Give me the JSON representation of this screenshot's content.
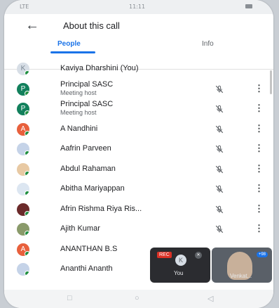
{
  "status_bar": {
    "network": "LTE",
    "time": "11:11"
  },
  "header": {
    "title": "About this call",
    "tabs": [
      "People",
      "Info"
    ]
  },
  "participants": [
    {
      "name": "Kaviya Dharshini (You)",
      "initial": "K",
      "color": "#d7dee6",
      "text_color": "#7a8793",
      "subtitle": "",
      "mic": false
    },
    {
      "name": "Principal SASC",
      "initial": "P",
      "color": "#12805c",
      "text_color": "#ffffff",
      "subtitle": "Meeting host",
      "mic": true
    },
    {
      "name": "Principal SASC",
      "initial": "P",
      "color": "#12805c",
      "text_color": "#ffffff",
      "subtitle": "Meeting host",
      "mic": true
    },
    {
      "name": "A Nandhini",
      "initial": "A",
      "color": "#e8603c",
      "text_color": "#ffffff",
      "subtitle": "",
      "mic": true
    },
    {
      "name": "Aafrin Parveen",
      "initial": "",
      "color": "#c5d3e8",
      "text_color": "#ffffff",
      "subtitle": "",
      "mic": true
    },
    {
      "name": "Abdul Rahaman",
      "initial": "",
      "color": "#e8c9a3",
      "text_color": "#ffffff",
      "subtitle": "",
      "mic": true
    },
    {
      "name": "Abitha Mariyappan",
      "initial": "",
      "color": "#dce6f1",
      "text_color": "#ffffff",
      "subtitle": "",
      "mic": true
    },
    {
      "name": "Afrin Rishma Riya Ris...",
      "initial": "",
      "color": "#6b2a2a",
      "text_color": "#ffffff",
      "subtitle": "",
      "mic": true
    },
    {
      "name": "Ajith Kumar",
      "initial": "",
      "color": "#8a9a6a",
      "text_color": "#ffffff",
      "subtitle": "",
      "mic": true
    },
    {
      "name": "ANANTHAN B.S",
      "initial": "A",
      "color": "#e8603c",
      "text_color": "#ffffff",
      "subtitle": "",
      "mic": false
    },
    {
      "name": "Ananthi Ananth",
      "initial": "",
      "color": "#c5d3e8",
      "text_color": "#ffffff",
      "subtitle": "",
      "mic": false
    }
  ],
  "self_tile": {
    "badge": "REC",
    "avatar_initial": "K",
    "label": "You"
  },
  "pip_tile": {
    "label": "Venkat...",
    "badge": "+98"
  },
  "colors": {
    "accent": "#1a73e8",
    "online": "#1e8e3e"
  }
}
